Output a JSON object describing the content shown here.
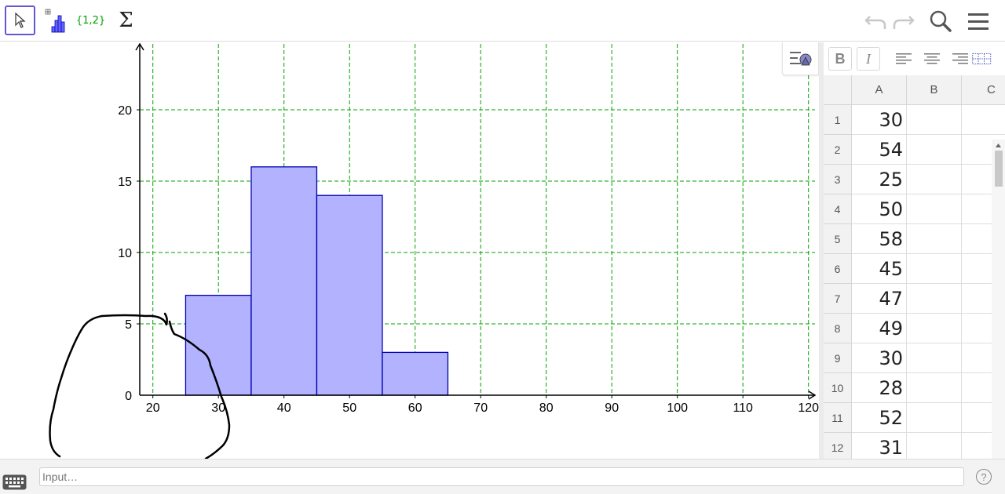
{
  "toolbar": {
    "tools": [
      {
        "name": "move-tool",
        "icon": "cursor-arrow-icon",
        "active": true
      },
      {
        "name": "histogram-tool",
        "icon": "histogram-icon"
      },
      {
        "name": "list-tool",
        "icon": "list-icon",
        "label": "{1,2}"
      },
      {
        "name": "sum-tool",
        "icon": "sigma-icon",
        "label": "Σ"
      }
    ],
    "right": [
      "undo-icon",
      "redo-icon",
      "search-icon",
      "menu-icon"
    ]
  },
  "chart_data": {
    "type": "bar",
    "bins": [
      [
        25,
        35
      ],
      [
        35,
        45
      ],
      [
        45,
        55
      ],
      [
        55,
        65
      ]
    ],
    "values": [
      7,
      16,
      14,
      3
    ],
    "xlim": [
      18,
      121
    ],
    "ylim": [
      0,
      24
    ],
    "xticks": [
      20,
      30,
      40,
      50,
      60,
      70,
      80,
      90,
      100,
      110,
      120
    ],
    "yticks": [
      0,
      5,
      10,
      15,
      20
    ],
    "grid": true,
    "bar_color": "#b2b2ff",
    "bar_edge_color": "#0000b2",
    "grid_color": "#00a000"
  },
  "spreadsheet": {
    "columns": [
      "A",
      "B",
      "C"
    ],
    "rows": [
      {
        "n": "1",
        "a": "30"
      },
      {
        "n": "2",
        "a": "54"
      },
      {
        "n": "3",
        "a": "25"
      },
      {
        "n": "4",
        "a": "50"
      },
      {
        "n": "5",
        "a": "58"
      },
      {
        "n": "6",
        "a": "45"
      },
      {
        "n": "7",
        "a": "47"
      },
      {
        "n": "8",
        "a": "49"
      },
      {
        "n": "9",
        "a": "30"
      },
      {
        "n": "10",
        "a": "28"
      },
      {
        "n": "11",
        "a": "52"
      },
      {
        "n": "12",
        "a": "31"
      }
    ],
    "format": {
      "bold": "B",
      "italic": "I"
    }
  },
  "input": {
    "placeholder": "Input…",
    "help": "?"
  }
}
